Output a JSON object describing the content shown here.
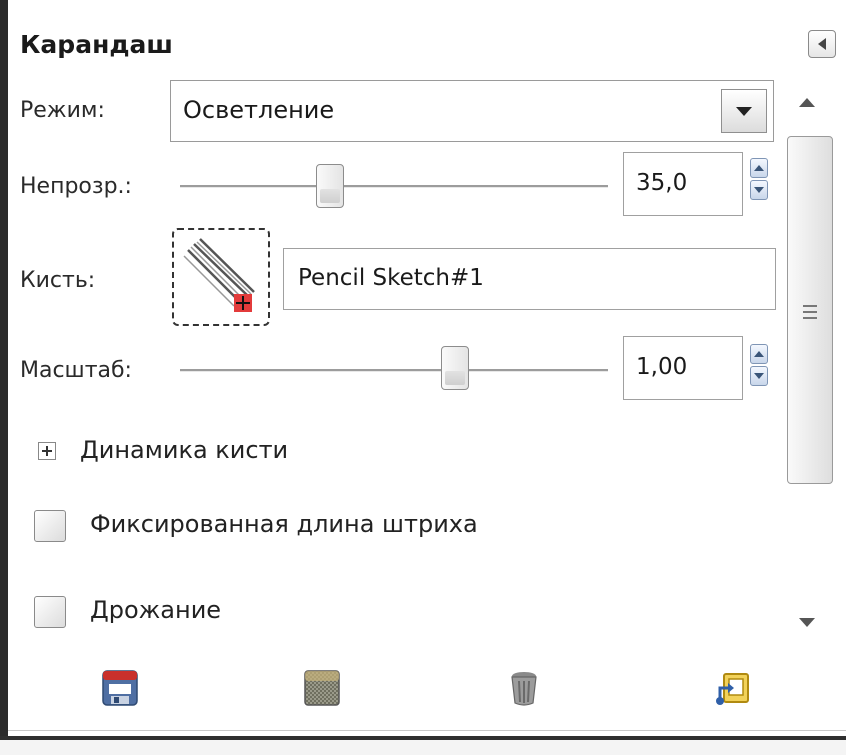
{
  "panel": {
    "title": "Карандаш"
  },
  "mode": {
    "label": "Режим:",
    "value": "Осветление"
  },
  "opacity": {
    "label": "Непрозр.:",
    "value": "35,0",
    "level_percent": 35
  },
  "brush": {
    "label": "Кисть:",
    "name": "Pencil Sketch#1"
  },
  "scale": {
    "label": "Масштаб:",
    "value": "1,00"
  },
  "dynamics": {
    "label": "Динамика кисти"
  },
  "options": {
    "fixed_stroke_length": "Фиксированная длина штриха",
    "jitter": "Дрожание"
  },
  "icons": {
    "bottom": [
      "save-icon",
      "restore-icon",
      "delete-icon",
      "reset-icon"
    ]
  },
  "colors": {
    "accent_blue": "#3a5578",
    "save_red": "#c9302c",
    "reset_yellow": "#e8c21a"
  }
}
